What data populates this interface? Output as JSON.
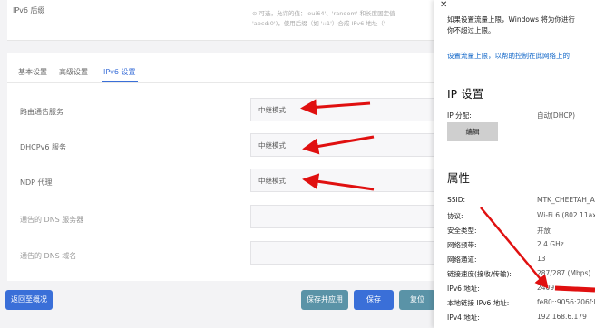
{
  "router": {
    "ipv6_suffix": {
      "label": "IPv6 后缀",
      "hint_line1": "⊙ 可选，允许的值：'eui64'、'random' 和长度固定值",
      "hint_line2": "'abcd:0')，使用后缀（如 '::1'）合成 IPv6 地址（'"
    },
    "tabs": [
      {
        "label": "基本设置",
        "active": false
      },
      {
        "label": "高级设置",
        "active": false
      },
      {
        "label": "IPv6 设置",
        "active": true
      }
    ],
    "fields": [
      {
        "label": "路由通告服务",
        "value": "中继模式"
      },
      {
        "label": "DHCPv6 服务",
        "value": "中继模式"
      },
      {
        "label": "NDP 代理",
        "value": "中继模式"
      },
      {
        "label": "通告的 DNS 服务器",
        "value": ""
      },
      {
        "label": "通告的 DNS 域名",
        "value": ""
      }
    ],
    "buttons": {
      "back": "返回至概况",
      "save_apply": "保存并应用",
      "save": "保存",
      "reset": "复位"
    }
  },
  "windows": {
    "top_line1": "如果设置流量上限，Windows 将为你进行",
    "top_line2": "你不超过上限。",
    "link": "设置流量上限，以帮助控制在此网络上的",
    "ip_heading": "IP 设置",
    "ip_assign_label": "IP 分配:",
    "ip_assign_value": "自动(DHCP)",
    "edit_button": "编辑",
    "props_heading": "属性",
    "properties": [
      {
        "label": "SSID:",
        "value": "MTK_CHEETAH_A"
      },
      {
        "label": "协议:",
        "value": "Wi-Fi 6 (802.11ax)"
      },
      {
        "label": "安全类型:",
        "value": "开放"
      },
      {
        "label": "网络频带:",
        "value": "2.4 GHz"
      },
      {
        "label": "网络通道:",
        "value": "13"
      },
      {
        "label": "链接速度(接收/传输):",
        "value": "287/287 (Mbps)"
      },
      {
        "label": "IPv6 地址:",
        "value": "2409:"
      },
      {
        "label": "本地链接 IPv6 地址:",
        "value": "fe80::9056:206f:b"
      },
      {
        "label": "IPv4 地址:",
        "value": "192.168.6.179"
      }
    ]
  },
  "colors": {
    "primary": "#3a6fd8",
    "save_apply": "#5a93a7",
    "annotation": "#e01010"
  }
}
